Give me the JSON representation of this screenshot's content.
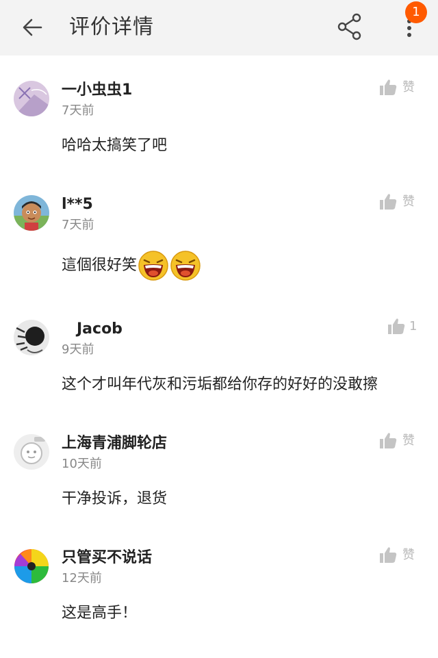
{
  "header": {
    "title": "评价详情",
    "notification_count": "1",
    "accent_color": "#ff5a00"
  },
  "icons": {
    "back": "arrow-left-icon",
    "share": "share-icon",
    "more": "more-vertical-icon",
    "like": "thumbs-up-icon",
    "emoji": "laughing-face-emoji"
  },
  "comments": [
    {
      "user": "一小虫虫1",
      "time": "7天前",
      "text": "哈哈太搞笑了吧",
      "like": "赞"
    },
    {
      "user": "l**5",
      "time": "7天前",
      "text": "這個很好笑",
      "like": "赞"
    },
    {
      "user": "Jacob",
      "time": "9天前",
      "text": "这个才叫年代灰和污垢都给你存的好好的没敢擦",
      "like": "1"
    },
    {
      "user": "上海青浦脚轮店",
      "time": "10天前",
      "text": "干净投诉，退货",
      "like": "赞"
    },
    {
      "user": "只管买不说话",
      "time": "12天前",
      "text": "这是高手！",
      "like": "赞"
    }
  ]
}
